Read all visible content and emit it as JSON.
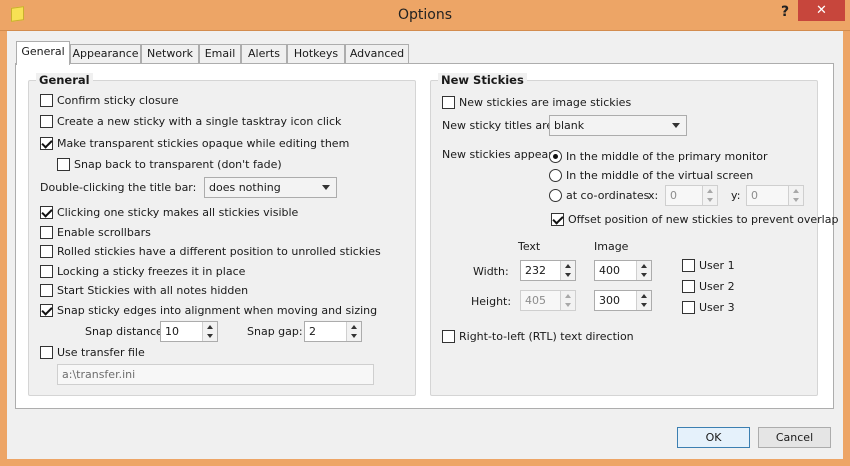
{
  "window": {
    "title": "Options",
    "help_glyph": "?",
    "close_glyph": "✕"
  },
  "tabs": [
    "General",
    "Appearance",
    "Network",
    "Email",
    "Alerts",
    "Hotkeys",
    "Advanced"
  ],
  "general": {
    "title": "General",
    "confirm_closure": "Confirm sticky closure",
    "single_click_new": "Create a new sticky with a single tasktray icon click",
    "transparent_opaque": "Make transparent stickies opaque while editing them",
    "snap_back": "Snap back to transparent (don't fade)",
    "double_click_label": "Double-clicking the title bar:",
    "double_click_value": "does nothing",
    "one_click_visible": "Clicking one sticky makes all stickies visible",
    "enable_scrollbars": "Enable scrollbars",
    "rolled_position": "Rolled stickies have a different position to unrolled stickies",
    "locking_freezes": "Locking a sticky freezes it in place",
    "start_hidden": "Start Stickies with all notes hidden",
    "snap_edges": "Snap sticky edges into alignment when moving and sizing",
    "snap_distance_label": "Snap distance:",
    "snap_distance_value": "10",
    "snap_gap_label": "Snap gap:",
    "snap_gap_value": "2",
    "use_transfer": "Use transfer file",
    "transfer_path": "a:\\transfer.ini"
  },
  "new_stickies": {
    "title": "New Stickies",
    "image_stickies": "New stickies are image stickies",
    "titles_label": "New sticky titles are:",
    "titles_value": "blank",
    "appear_label": "New stickies appear:",
    "middle_primary": "In the middle of the primary monitor",
    "middle_virtual": "In the middle of the virtual screen",
    "coordinates": "at co-ordinates",
    "x_label": "x:",
    "x_value": "0",
    "y_label": "y:",
    "y_value": "0",
    "offset_overlap": "Offset position of new stickies to prevent overlap",
    "text_header": "Text",
    "image_header": "Image",
    "width_label": "Width:",
    "height_label": "Height:",
    "text_width": "232",
    "text_height": "405",
    "image_width": "400",
    "image_height": "300",
    "user1": "User 1",
    "user2": "User 2",
    "user3": "User 3",
    "rtl": "Right-to-left (RTL) text direction"
  },
  "buttons": {
    "ok": "OK",
    "cancel": "Cancel"
  },
  "colors": {
    "frame": "#eda566",
    "close": "#c7463c",
    "default_button": "#3c7fb1"
  }
}
